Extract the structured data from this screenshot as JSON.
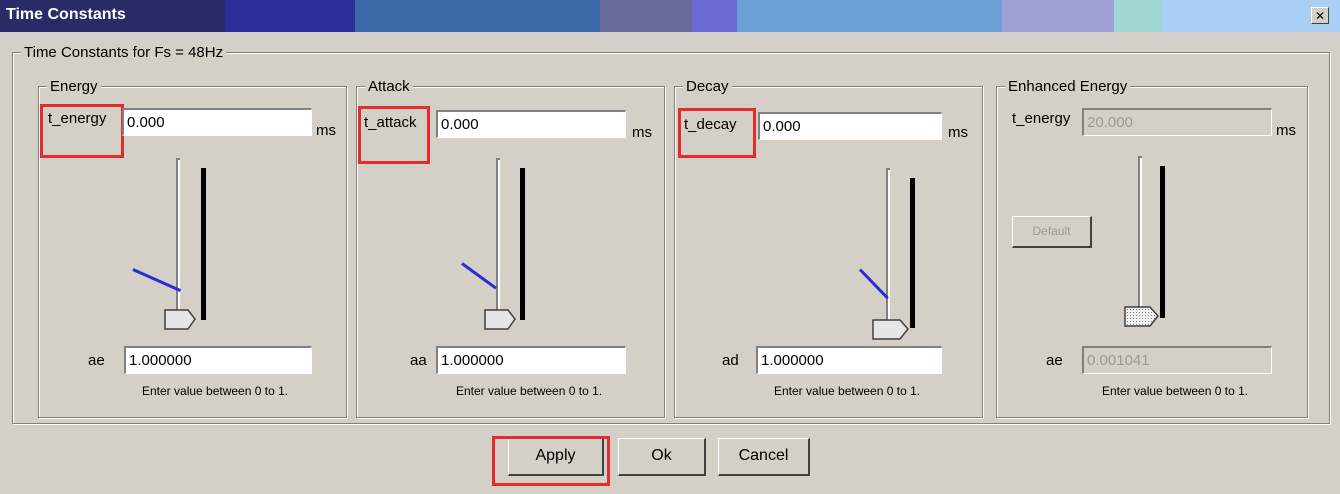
{
  "window": {
    "title": "Time Constants",
    "close_glyph": "✕"
  },
  "outer_group": {
    "legend": "Time Constants for Fs = 48Hz"
  },
  "panels": [
    {
      "legend": "Energy",
      "t_label": "t_energy",
      "t_value": "0.000",
      "unit": "ms",
      "a_label": "ae",
      "a_value": "1.000000",
      "hint": "Enter value between 0 to 1.",
      "slider_level": 0
    },
    {
      "legend": "Attack",
      "t_label": "t_attack",
      "t_value": "0.000",
      "unit": "ms",
      "a_label": "aa",
      "a_value": "1.000000",
      "hint": "Enter value between 0 to 1.",
      "slider_level": 0
    },
    {
      "legend": "Decay",
      "t_label": "t_decay",
      "t_value": "0.000",
      "unit": "ms",
      "a_label": "ad",
      "a_value": "1.000000",
      "hint": "Enter value between 0 to 1.",
      "slider_level": 0
    },
    {
      "legend": "Enhanced Energy",
      "t_label": "t_energy",
      "t_value": "20.000",
      "unit": "ms",
      "a_label": "ae",
      "a_value": "0.001041",
      "hint": "Enter value between 0 to 1.",
      "default_label": "Default",
      "slider_level": 0
    }
  ],
  "buttons": {
    "apply": "Apply",
    "ok": "Ok",
    "cancel": "Cancel"
  },
  "colors": {
    "highlight": "#e52b2b",
    "annotation_stroke": "#2b2bd6",
    "dialog_bg": "#d4d0c8"
  },
  "icons": {
    "thumb": "slider-thumb-icon"
  }
}
